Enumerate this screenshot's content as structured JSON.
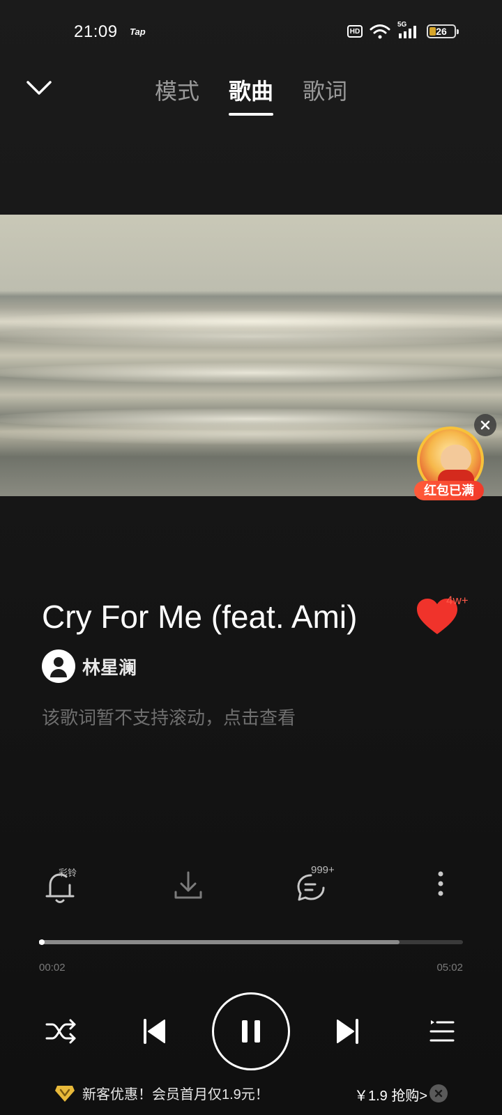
{
  "status_bar": {
    "time": "21:09",
    "app_indicator": "Tap",
    "hd_label": "HD",
    "network_label": "5G",
    "battery": "26",
    "battery_level": 0.26
  },
  "header": {
    "collapse_icon": "chevron-down-icon",
    "tabs": [
      {
        "label": "模式",
        "active": false
      },
      {
        "label": "歌曲",
        "active": true
      },
      {
        "label": "歌词",
        "active": false
      }
    ]
  },
  "red_packet": {
    "label": "红包已满",
    "close_icon": "close-icon"
  },
  "song": {
    "title": "Cry For Me (feat. Ami)",
    "like_count": "4w+",
    "like_color": "#f0332b",
    "artist": "林星澜",
    "lyric_hint": "该歌词暂不支持滚动，点击查看"
  },
  "actions": {
    "ringtone_badge": "彩铃",
    "comment_count": "999+",
    "icons": [
      "bell-icon",
      "download-icon",
      "comment-icon",
      "more-icon"
    ]
  },
  "progress": {
    "current": "00:02",
    "duration": "05:02",
    "played_fraction": 0.007,
    "buffered_fraction": 0.85
  },
  "controls": {
    "icons": [
      "shuffle-icon",
      "previous-icon",
      "pause-icon",
      "next-icon",
      "playlist-icon"
    ]
  },
  "promo": {
    "text": "新客优惠！会员首月仅1.9元！",
    "price": "￥1.9 抢购>",
    "accent": "#e8b93a"
  }
}
